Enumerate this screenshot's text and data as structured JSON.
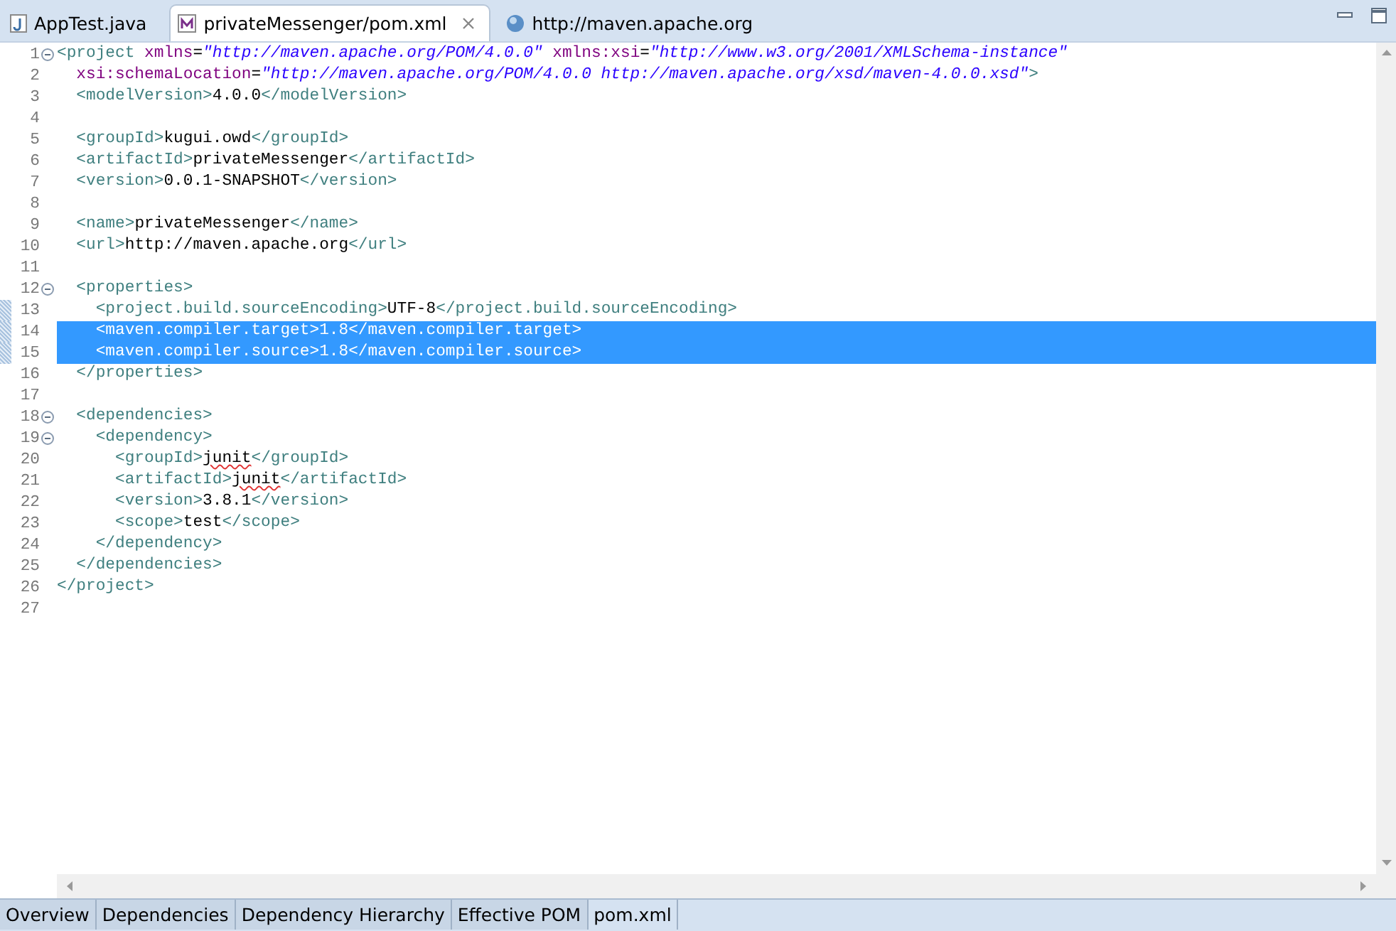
{
  "tabs": [
    {
      "label": "AppTest.java",
      "kind": "java",
      "selected": false
    },
    {
      "label": "privateMessenger/pom.xml",
      "kind": "maven",
      "selected": true
    },
    {
      "label": "http://maven.apache.org",
      "kind": "web",
      "selected": false
    }
  ],
  "editor": {
    "lines": [
      {
        "number": "1",
        "foldable": true,
        "changed": false,
        "selected": false,
        "tokens": [
          {
            "kind": "tag",
            "text": "<project"
          },
          {
            "kind": "attr",
            "text": " xmlns"
          },
          {
            "kind": "plain",
            "text": "="
          },
          {
            "kind": "string",
            "text": "\"http://maven.apache.org/POM/4.0.0\""
          },
          {
            "kind": "attr",
            "text": " xmlns:xsi"
          },
          {
            "kind": "plain",
            "text": "="
          },
          {
            "kind": "string",
            "text": "\"http://www.w3.org/2001/XMLSchema-instance\""
          }
        ]
      },
      {
        "number": "2",
        "foldable": false,
        "changed": false,
        "selected": false,
        "tokens": [
          {
            "kind": "attr",
            "text": "  xsi:schemaLocation"
          },
          {
            "kind": "plain",
            "text": "="
          },
          {
            "kind": "string",
            "text": "\"http://maven.apache.org/POM/4.0.0 http://maven.apache.org/xsd/maven-4.0.0.xsd\""
          },
          {
            "kind": "tag",
            "text": ">"
          }
        ]
      },
      {
        "number": "3",
        "foldable": false,
        "changed": false,
        "selected": false,
        "tokens": [
          {
            "kind": "tag",
            "text": "  <modelVersion>"
          },
          {
            "kind": "text",
            "text": "4.0.0"
          },
          {
            "kind": "tag",
            "text": "</modelVersion>"
          }
        ]
      },
      {
        "number": "4",
        "foldable": false,
        "changed": false,
        "selected": false
      },
      {
        "number": "5",
        "foldable": false,
        "changed": false,
        "selected": false,
        "tokens": [
          {
            "kind": "tag",
            "text": "  <groupId>"
          },
          {
            "kind": "text",
            "text": "kugui.owd"
          },
          {
            "kind": "tag",
            "text": "</groupId>"
          }
        ]
      },
      {
        "number": "6",
        "foldable": false,
        "changed": false,
        "selected": false,
        "tokens": [
          {
            "kind": "tag",
            "text": "  <artifactId>"
          },
          {
            "kind": "text",
            "text": "privateMessenger"
          },
          {
            "kind": "tag",
            "text": "</artifactId>"
          }
        ]
      },
      {
        "number": "7",
        "foldable": false,
        "changed": false,
        "selected": false,
        "tokens": [
          {
            "kind": "tag",
            "text": "  <version>"
          },
          {
            "kind": "text",
            "text": "0.0.1-SNAPSHOT"
          },
          {
            "kind": "tag",
            "text": "</version>"
          }
        ]
      },
      {
        "number": "8",
        "foldable": false,
        "changed": false,
        "selected": false
      },
      {
        "number": "9",
        "foldable": false,
        "changed": false,
        "selected": false,
        "tokens": [
          {
            "kind": "tag",
            "text": "  <name>"
          },
          {
            "kind": "text",
            "text": "privateMessenger"
          },
          {
            "kind": "tag",
            "text": "</name>"
          }
        ]
      },
      {
        "number": "10",
        "foldable": false,
        "changed": false,
        "selected": false,
        "tokens": [
          {
            "kind": "tag",
            "text": "  <url>"
          },
          {
            "kind": "text",
            "text": "http://maven.apache.org"
          },
          {
            "kind": "tag",
            "text": "</url>"
          }
        ]
      },
      {
        "number": "11",
        "foldable": false,
        "changed": false,
        "selected": false
      },
      {
        "number": "12",
        "foldable": true,
        "changed": false,
        "selected": false,
        "tokens": [
          {
            "kind": "tag",
            "text": "  <properties>"
          }
        ]
      },
      {
        "number": "13",
        "foldable": false,
        "changed": true,
        "selected": false,
        "tokens": [
          {
            "kind": "tag",
            "text": "    <project.build.sourceEncoding>"
          },
          {
            "kind": "text",
            "text": "UTF-8"
          },
          {
            "kind": "tag",
            "text": "</project.build.sourceEncoding>"
          }
        ]
      },
      {
        "number": "14",
        "foldable": false,
        "changed": true,
        "selected": true,
        "tokens": [
          {
            "kind": "tag",
            "text": "    <maven.compiler.target>"
          },
          {
            "kind": "text",
            "text": "1.8"
          },
          {
            "kind": "tag",
            "text": "</maven.compiler.target>"
          }
        ]
      },
      {
        "number": "15",
        "foldable": false,
        "changed": true,
        "selected": true,
        "tokens": [
          {
            "kind": "tag",
            "text": "    <maven.compiler.source>"
          },
          {
            "kind": "text",
            "text": "1.8"
          },
          {
            "kind": "tag",
            "text": "</maven.compiler.source>"
          }
        ]
      },
      {
        "number": "16",
        "foldable": false,
        "changed": false,
        "selected": false,
        "tokens": [
          {
            "kind": "tag",
            "text": "  </properties>"
          }
        ]
      },
      {
        "number": "17",
        "foldable": false,
        "changed": false,
        "selected": false
      },
      {
        "number": "18",
        "foldable": true,
        "changed": false,
        "selected": false,
        "tokens": [
          {
            "kind": "tag",
            "text": "  <dependencies>"
          }
        ]
      },
      {
        "number": "19",
        "foldable": true,
        "changed": false,
        "selected": false,
        "tokens": [
          {
            "kind": "tag",
            "text": "    <dependency>"
          }
        ]
      },
      {
        "number": "20",
        "foldable": false,
        "changed": false,
        "selected": false,
        "tokens": [
          {
            "kind": "tag",
            "text": "      <groupId>"
          },
          {
            "kind": "misspelled",
            "text": "junit"
          },
          {
            "kind": "tag",
            "text": "</groupId>"
          }
        ]
      },
      {
        "number": "21",
        "foldable": false,
        "changed": false,
        "selected": false,
        "tokens": [
          {
            "kind": "tag",
            "text": "      <artifactId>"
          },
          {
            "kind": "misspelled",
            "text": "junit"
          },
          {
            "kind": "tag",
            "text": "</artifactId>"
          }
        ]
      },
      {
        "number": "22",
        "foldable": false,
        "changed": false,
        "selected": false,
        "tokens": [
          {
            "kind": "tag",
            "text": "      <version>"
          },
          {
            "kind": "text",
            "text": "3.8.1"
          },
          {
            "kind": "tag",
            "text": "</version>"
          }
        ]
      },
      {
        "number": "23",
        "foldable": false,
        "changed": false,
        "selected": false,
        "tokens": [
          {
            "kind": "tag",
            "text": "      <scope>"
          },
          {
            "kind": "text",
            "text": "test"
          },
          {
            "kind": "tag",
            "text": "</scope>"
          }
        ]
      },
      {
        "number": "24",
        "foldable": false,
        "changed": false,
        "selected": false,
        "tokens": [
          {
            "kind": "tag",
            "text": "    </dependency>"
          }
        ]
      },
      {
        "number": "25",
        "foldable": false,
        "changed": false,
        "selected": false,
        "tokens": [
          {
            "kind": "tag",
            "text": "  </dependencies>"
          }
        ]
      },
      {
        "number": "26",
        "foldable": false,
        "changed": false,
        "selected": false,
        "tokens": [
          {
            "kind": "tag",
            "text": "</project>"
          }
        ]
      },
      {
        "number": "27",
        "foldable": false,
        "changed": false,
        "selected": false
      }
    ]
  },
  "bottom_tabs": [
    {
      "label": "Overview",
      "selected": false
    },
    {
      "label": "Dependencies",
      "selected": false
    },
    {
      "label": "Dependency Hierarchy",
      "selected": false
    },
    {
      "label": "Effective POM",
      "selected": false
    },
    {
      "label": "pom.xml",
      "selected": true
    }
  ]
}
